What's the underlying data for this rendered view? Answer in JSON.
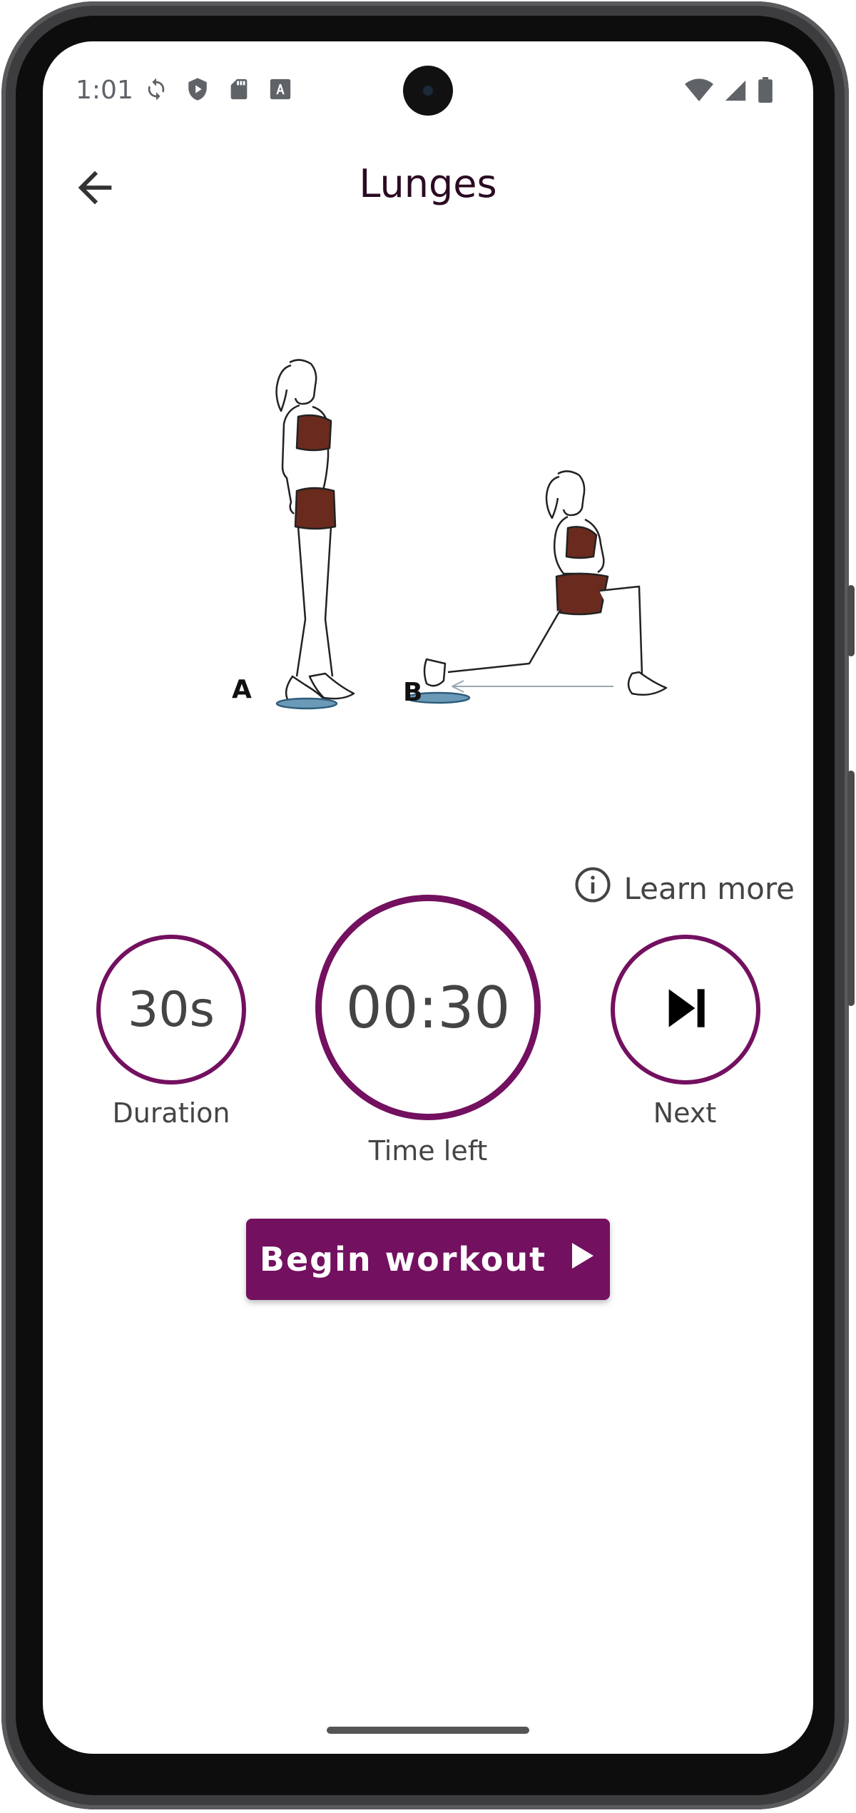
{
  "status_bar": {
    "time": "1:01",
    "left_icons": [
      "sync-icon",
      "shield-icon",
      "sd-card-icon",
      "font-icon"
    ],
    "right_icons": [
      "wifi-icon",
      "signal-icon",
      "battery-icon"
    ]
  },
  "header": {
    "title": "Lunges",
    "back_icon": "arrow-back-icon"
  },
  "illustration": {
    "label_a": "A",
    "label_b": "B"
  },
  "learn_more": {
    "label": "Learn more",
    "icon": "info-icon"
  },
  "controls": {
    "duration": {
      "value": "30s",
      "label": "Duration"
    },
    "time_left": {
      "value": "00:30",
      "label": "Time left"
    },
    "next": {
      "label": "Next",
      "icon": "skip-next-icon"
    }
  },
  "begin_button": {
    "label": "Begin workout",
    "icon": "play-icon"
  },
  "colors": {
    "accent": "#73105f",
    "title": "#2b0a22",
    "text": "#444444"
  }
}
